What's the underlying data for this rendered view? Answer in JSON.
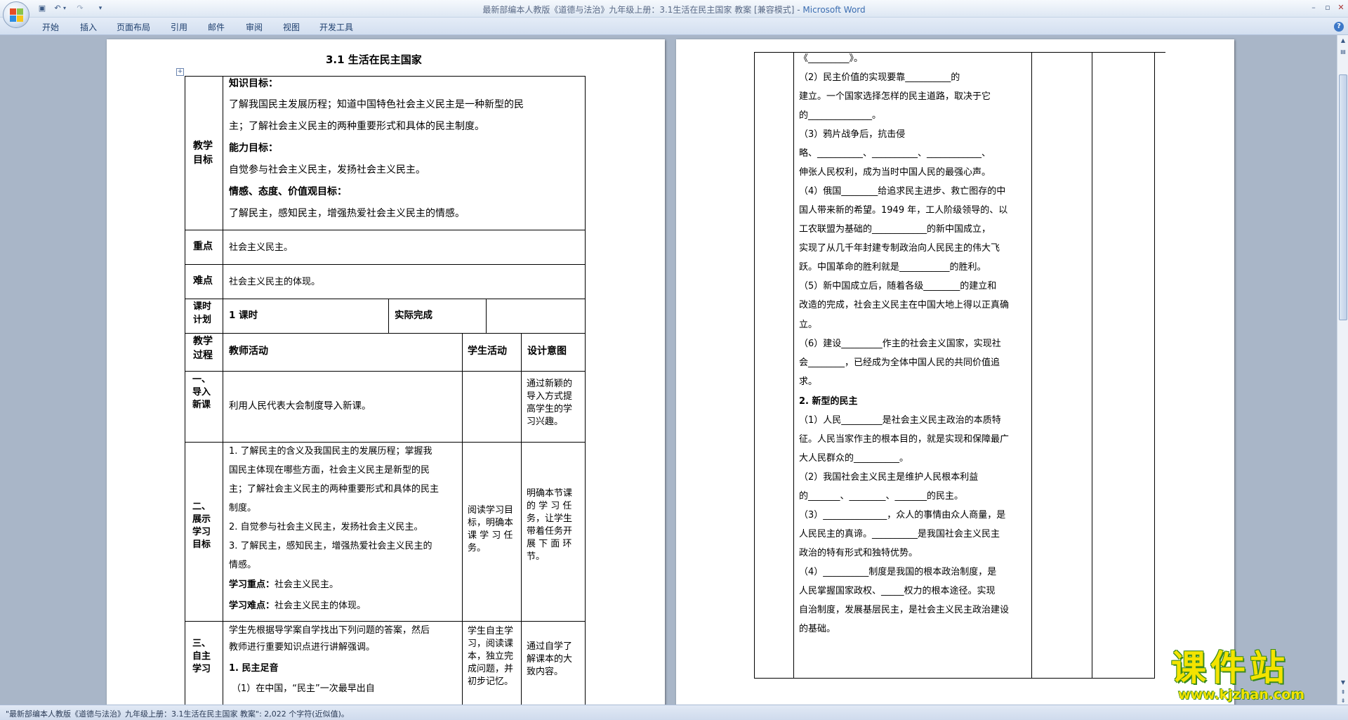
{
  "window": {
    "title": "最新部编本人教版《道德与法治》九年级上册：3.1生活在民主国家 教案 [兼容模式] - ",
    "app": "Microsoft Word"
  },
  "ribbon": {
    "tabs": [
      "开始",
      "插入",
      "页面布局",
      "引用",
      "邮件",
      "审阅",
      "视图",
      "开发工具"
    ]
  },
  "statusbar": {
    "text": "\"最新部编本人教版《道德与法治》九年级上册：3.1生活在民主国家 教案\": 2,022 个字符(近似值)。"
  },
  "watermark": {
    "title": "课件站",
    "url": "www.kjzhan.com"
  },
  "page1": {
    "doc_title": "3.1   生活在民主国家",
    "rows": {
      "goals": {
        "label": [
          "教学",
          "目标"
        ],
        "lines": [
          "知识目标：",
          "了解我国民主发展历程；知道中国特色社会主义民主是一种新型的民",
          "主；了解社会主义民主的两种重要形式和具体的民主制度。",
          "能力目标：",
          "自觉参与社会主义民主，发扬社会主义民主。",
          "情感、态度、价值观目标：",
          "了解民主，感知民主，增强热爱社会主义民主的情感。"
        ]
      },
      "key": {
        "label": "重点",
        "text": "社会主义民主。"
      },
      "difficult": {
        "label": "难点",
        "text": "社会主义民主的体现。"
      },
      "plan": {
        "label": [
          "课时",
          "计划"
        ],
        "hours": "1 课时",
        "actual": "实际完成"
      },
      "process_header": {
        "label": [
          "教学",
          "过程"
        ],
        "teacher": "教师活动",
        "student": "学生活动",
        "design": "设计意图"
      },
      "intro": {
        "label": [
          "一、",
          "导入",
          "新课"
        ],
        "teacher": "利用人民代表大会制度导入新课。",
        "design": [
          "通过新颖的",
          "导入方式提",
          "高学生的学",
          "习兴趣。"
        ]
      },
      "show": {
        "label": [
          "二、",
          "展示",
          "学习",
          "目标"
        ],
        "teacher": [
          "1. 了解民主的含义及我国民主的发展历程；掌握我",
          "国民主体现在哪些方面，社会主义民主是新型的民",
          "主；了解社会主义民主的两种重要形式和具体的民主",
          "制度。",
          "2. 自觉参与社会主义民主，发扬社会主义民主。",
          "3. 了解民主，感知民主，增强热爱社会主义民主的",
          "情感。"
        ],
        "key_label": "学习重点：",
        "key_text": "社会主义民主。",
        "diff_label": "学习难点：",
        "diff_text": "社会主义民主的体现。",
        "student": [
          "阅读学习目",
          "标，明确本",
          "课 学 习 任",
          "务。"
        ],
        "design": [
          "明确本节课",
          "的 学 习 任",
          "务，让学生",
          "带着任务开",
          "展 下 面 环",
          "节。"
        ]
      },
      "self": {
        "label": [
          "三、",
          "自主",
          "学习"
        ],
        "teacher": [
          "学生先根据导学案自学找出下列问题的答案，然后",
          "教师进行重要知识点进行讲解强调。"
        ],
        "sub1": "1. 民主足音",
        "item1": "（1）在中国，“民主”一次最早出自",
        "student": [
          "学生自主学",
          "习，阅读课",
          "本，独立完",
          "成问题，并",
          "初步记忆。"
        ],
        "design": [
          "通过自学了",
          "解课本的大",
          "致内容。"
        ]
      }
    }
  },
  "page2": {
    "lines": [
      "《_________》。",
      "（2）民主价值的实现要靠__________的",
      "建立。一个国家选择怎样的民主道路，取决于它",
      "的______________。",
      "（3）鸦片战争后，抗击侵",
      "略、__________、__________、____________、",
      "伸张人民权利，成为当时中国人民的最强心声。",
      "（4）俄国________给追求民主进步、救亡图存的中",
      "国人带来新的希望。1949 年，工人阶级领导的、以",
      "工农联盟为基础的____________的新中国成立，",
      "实现了从几千年封建专制政治向人民民主的伟大飞",
      "跃。中国革命的胜利就是___________的胜利。",
      "（5）新中国成立后，随着各级________的建立和",
      "改造的完成，社会主义民主在中国大地上得以正真确",
      "立。",
      "（6）建设_________作主的社会主义国家，实现社",
      "会________，已经成为全体中国人民的共同价值追",
      "求。",
      "2. 新型的民主",
      "（1）人民_________是社会主义民主政治的本质特",
      "征。人民当家作主的根本目的，就是实现和保障最广",
      "大人民群众的__________。",
      "（2）我国社会主义民主是维护人民根本利益",
      "的_______、________、_______的民主。",
      "（3）______________，众人的事情由众人商量，是",
      "人民民主的真谛。__________是我国社会主义民主",
      "政治的特有形式和独特优势。",
      "（4）__________制度是我国的根本政治制度，是",
      "人民掌握国家政权、_____权力的根本途径。实现",
      "自治制度，发展基层民主，是社会主义民主政治建设",
      "的基础。"
    ]
  },
  "colors": {
    "ribbon": "#d3dff0",
    "docbg": "#a9b6c8",
    "watermark": "#f3e300"
  }
}
